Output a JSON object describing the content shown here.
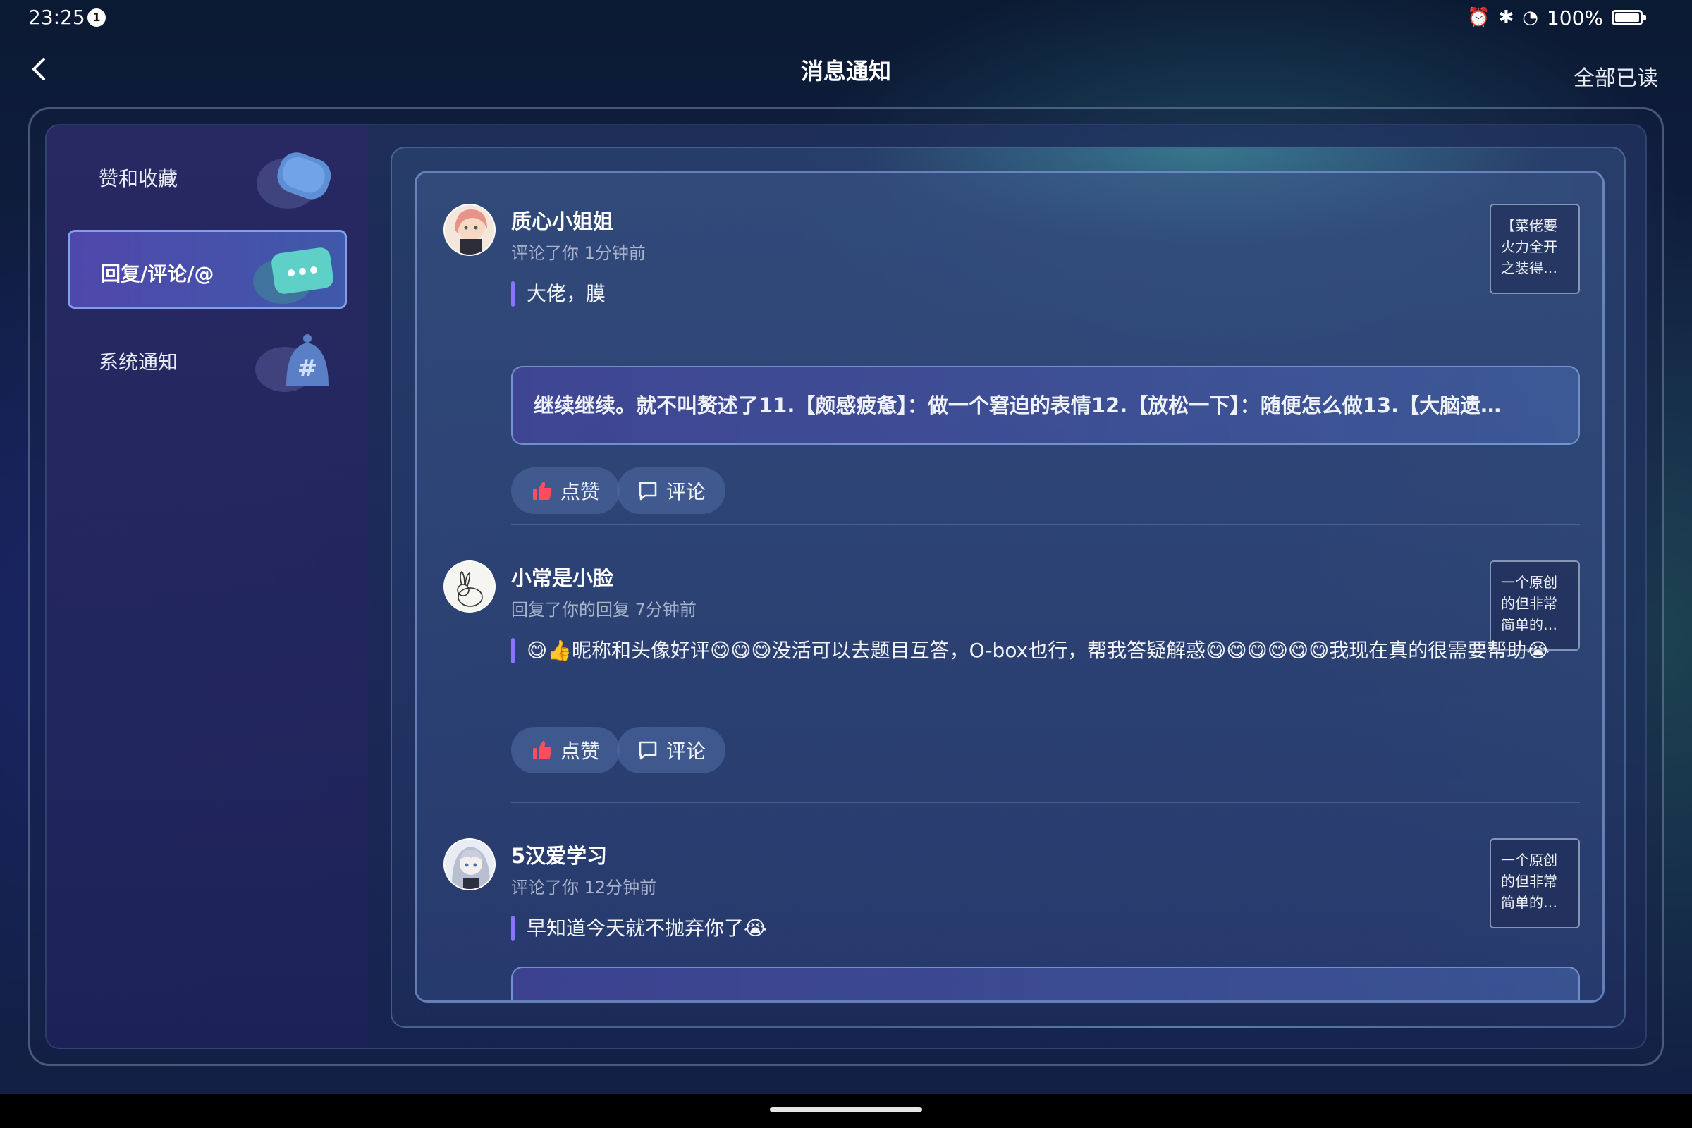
{
  "status_bar": {
    "time": "23:25",
    "notification_count": "1",
    "battery": "100%",
    "icons": [
      "alarm-icon",
      "bluetooth-icon",
      "wifi-icon",
      "battery-icon"
    ]
  },
  "header": {
    "title": "消息通知",
    "mark_all_read": "全部已读"
  },
  "sidebar": {
    "items": [
      {
        "label": "赞和收藏",
        "icon": "heart-bubble-icon",
        "active": false
      },
      {
        "label": "回复/评论/@",
        "icon": "chat-bubble-icon",
        "active": true
      },
      {
        "label": "系统通知",
        "icon": "bell-hash-icon",
        "active": false
      }
    ]
  },
  "colors": {
    "accent": "#8a74ff",
    "like_red": "#ff4d5e",
    "active_tab_border": "#8cb4ff"
  },
  "notifications": [
    {
      "username": "质心小姐姐",
      "meta": "评论了你 1分钟前",
      "ref": [
        "【菜佬要",
        "火力全开",
        "之装得…"
      ],
      "quote": "大佬，膜",
      "reply": "继续继续。就不叫赘述了11.【颇感疲惫】：做一个窘迫的表情12.【放松一下】：随便怎么做13.【大脑遗…",
      "like_label": "点赞",
      "comment_label": "评论"
    },
    {
      "username": "小常是小脸",
      "meta": "回复了你的回复 7分钟前",
      "ref": [
        "一个原创",
        "的但非常",
        "简单的…"
      ],
      "quote": "😋👍昵称和头像好评😋😋😋没活可以去题目互答，O-box也行，帮我答疑解惑😋😋😋😋😋😋我现在真的很需要帮助😭",
      "like_label": "点赞",
      "comment_label": "评论"
    },
    {
      "username": "5汉爱学习",
      "meta": "评论了你 12分钟前",
      "ref": [
        "一个原创",
        "的但非常",
        "简单的…"
      ],
      "quote": "早知道今天就不抛弃你了😭"
    }
  ]
}
